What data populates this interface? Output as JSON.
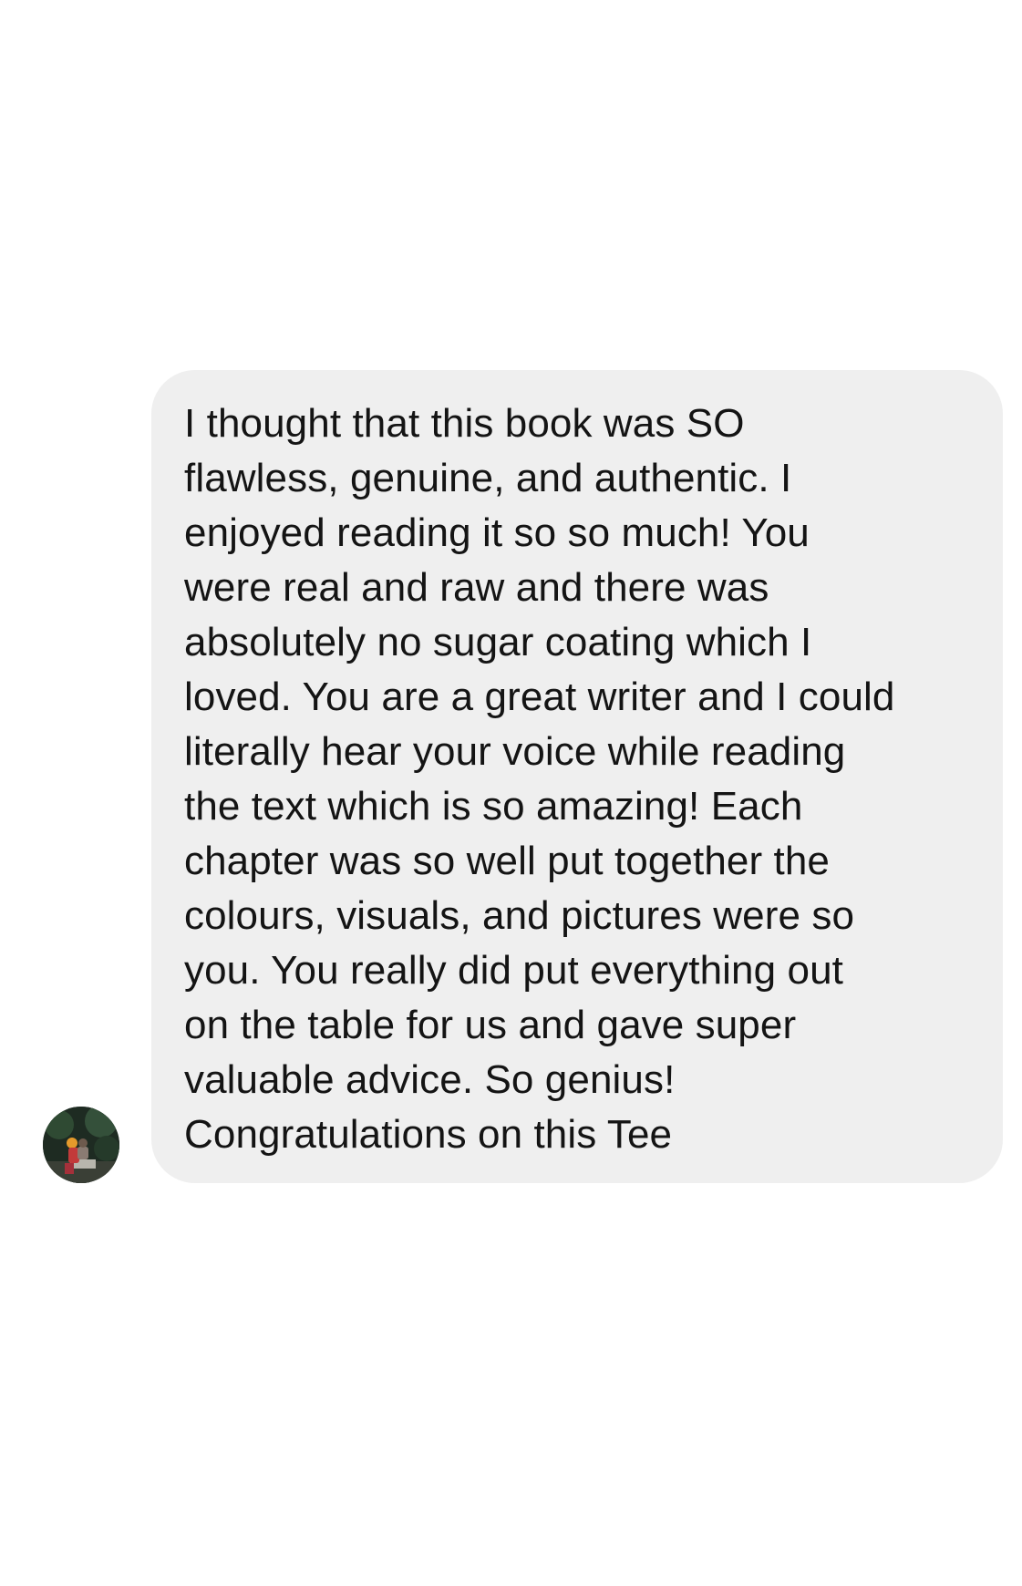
{
  "message": {
    "sender_avatar_icon": "avatar-photo",
    "bubble_color": "#efefef",
    "text_color": "#141414",
    "lines": [
      "I thought that this book was SO",
      "flawless, genuine, and authentic. I",
      "enjoyed reading it so so much! You",
      "were real and raw and there was",
      "absolutely no sugar coating which I",
      "loved. You are a great writer and I could",
      "literally hear your voice while reading",
      "the text which is so amazing! Each",
      "chapter was so well put together the",
      "colours, visuals, and pictures were so",
      "you. You really did put everything out",
      "on the table for us and gave super",
      "valuable advice. So genius!",
      "Congratulations on this Tee"
    ]
  }
}
